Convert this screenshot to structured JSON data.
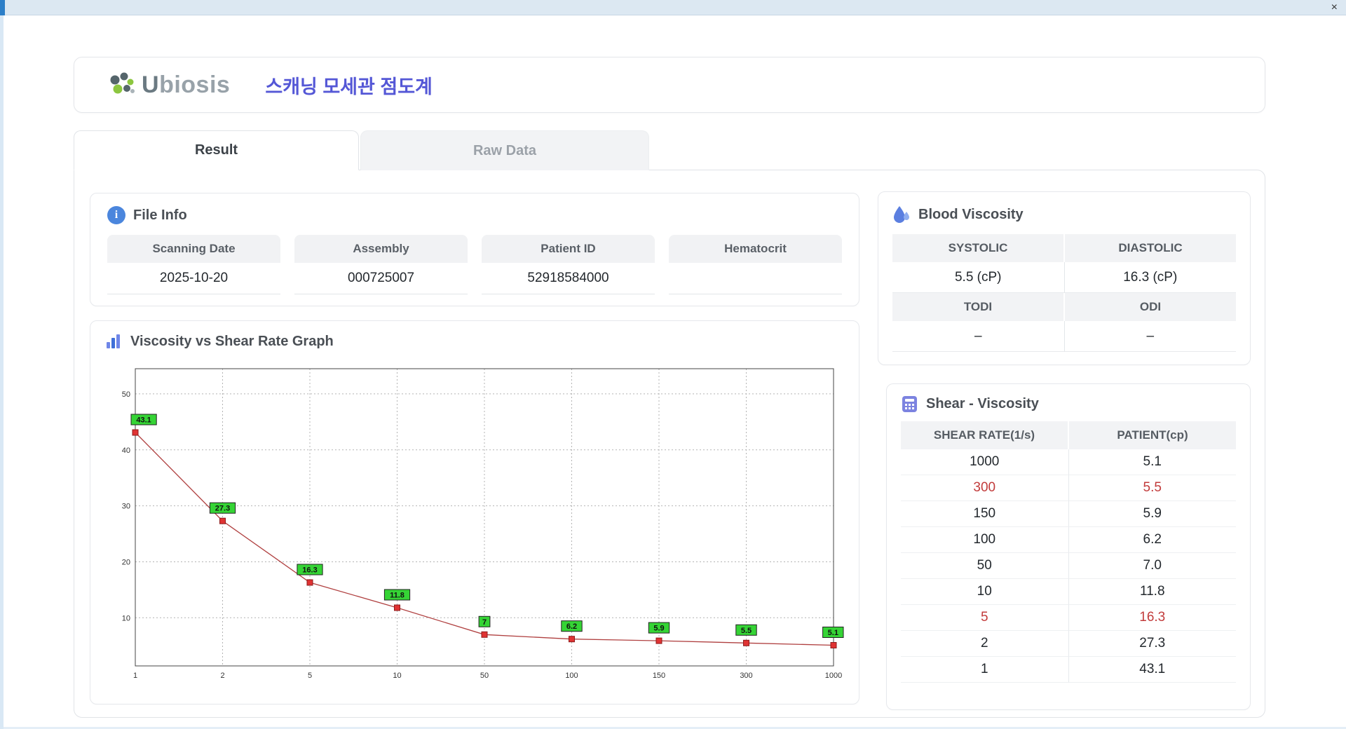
{
  "window": {
    "close_glyph": "×"
  },
  "header": {
    "logo_text_u": "U",
    "logo_text_rest": "biosis",
    "app_title": "스캐닝 모세관 점도계"
  },
  "tabs": [
    {
      "label": "Result",
      "active": true
    },
    {
      "label": "Raw Data",
      "active": false
    }
  ],
  "file_info": {
    "title": "File Info",
    "info_icon_glyph": "i",
    "fields": [
      {
        "label": "Scanning Date",
        "value": "2025-10-20"
      },
      {
        "label": "Assembly",
        "value": "000725007"
      },
      {
        "label": "Patient ID",
        "value": "52918584000"
      },
      {
        "label": "Hematocrit",
        "value": ""
      }
    ]
  },
  "graph": {
    "title": "Viscosity vs Shear Rate Graph"
  },
  "blood_viscosity": {
    "title": "Blood Viscosity",
    "rows": [
      {
        "labels": [
          "SYSTOLIC",
          "DIASTOLIC"
        ],
        "values": [
          "5.5 (cP)",
          "16.3 (cP)"
        ]
      },
      {
        "labels": [
          "TODI",
          "ODI"
        ],
        "values": [
          "–",
          "–"
        ]
      }
    ]
  },
  "shear_viscosity": {
    "title": "Shear - Viscosity",
    "columns": [
      "SHEAR RATE(1/s)",
      "PATIENT(cp)"
    ],
    "rows": [
      {
        "shear": "1000",
        "patient": "5.1",
        "highlight": false
      },
      {
        "shear": "300",
        "patient": "5.5",
        "highlight": true
      },
      {
        "shear": "150",
        "patient": "5.9",
        "highlight": false
      },
      {
        "shear": "100",
        "patient": "6.2",
        "highlight": false
      },
      {
        "shear": "50",
        "patient": "7.0",
        "highlight": false
      },
      {
        "shear": "10",
        "patient": "11.8",
        "highlight": false
      },
      {
        "shear": "5",
        "patient": "16.3",
        "highlight": true
      },
      {
        "shear": "2",
        "patient": "27.3",
        "highlight": false
      },
      {
        "shear": "1",
        "patient": "43.1",
        "highlight": false
      }
    ]
  },
  "chart_data": {
    "type": "line",
    "title": "Viscosity vs Shear Rate Graph",
    "x_scale": "categorical-even",
    "categories": [
      "1",
      "2",
      "5",
      "10",
      "50",
      "100",
      "150",
      "300",
      "1000"
    ],
    "x": [
      1,
      2,
      5,
      10,
      50,
      100,
      150,
      300,
      1000
    ],
    "values": [
      43.1,
      27.3,
      16.3,
      11.8,
      7,
      6.2,
      5.9,
      5.5,
      5.1
    ],
    "point_labels": [
      "43.1",
      "27.3",
      "16.3",
      "11.8",
      "7",
      "6.2",
      "5.9",
      "5.5",
      "5.1"
    ],
    "xlabel": "",
    "ylabel": "",
    "yticks": [
      10,
      20,
      30,
      40,
      50
    ],
    "ylim": [
      1.4,
      54.5
    ],
    "grid": "dashed",
    "legend": "none",
    "line_color": "#b04040",
    "marker_color": "#e03333",
    "marker_border": "#8e1b1b",
    "label_bg": "#35d435",
    "label_border": "#222222"
  },
  "colors": {
    "accent_title": "#5457d6",
    "highlight_red": "#c23b3b",
    "header_gray": "#f2f3f5",
    "titlebar_blue": "#dce8f2"
  }
}
